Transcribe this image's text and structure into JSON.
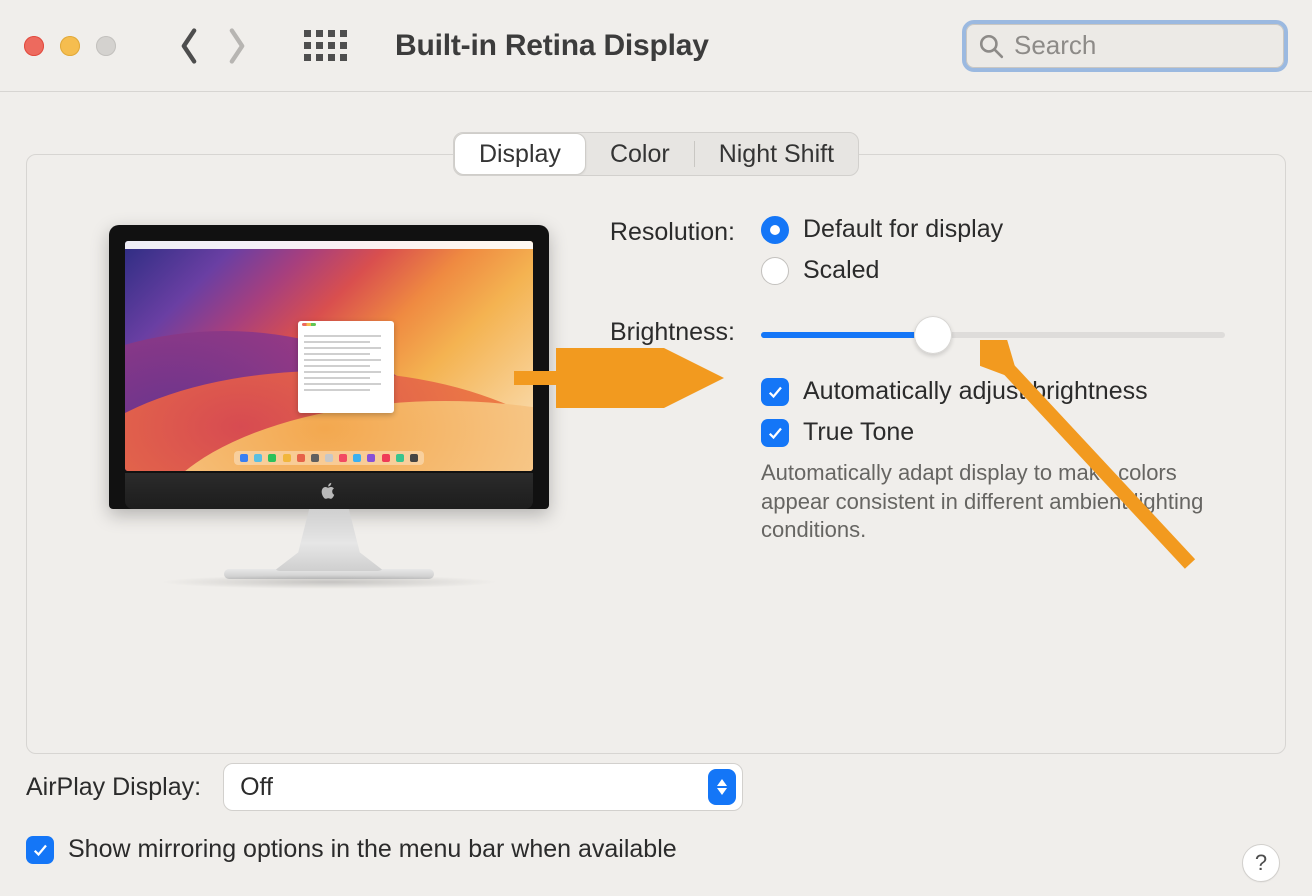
{
  "toolbar": {
    "title": "Built-in Retina Display",
    "search_placeholder": "Search"
  },
  "tabs": {
    "display": "Display",
    "color": "Color",
    "night_shift": "Night Shift",
    "active_index": 0
  },
  "settings": {
    "resolution_label": "Resolution:",
    "resolution_options": {
      "default": "Default for display",
      "scaled": "Scaled"
    },
    "resolution_selected": "default",
    "brightness_label": "Brightness:",
    "brightness_value_percent": 37,
    "auto_brightness_label": "Automatically adjust brightness",
    "auto_brightness_checked": true,
    "true_tone_label": "True Tone",
    "true_tone_checked": true,
    "true_tone_caption": "Automatically adapt display to make colors appear consistent in different ambient lighting conditions."
  },
  "footer": {
    "airplay_label": "AirPlay Display:",
    "airplay_value": "Off",
    "mirroring_label": "Show mirroring options in the menu bar when available",
    "mirroring_checked": true,
    "help_label": "?"
  },
  "colors": {
    "accent": "#1476f7",
    "annotation": "#f29a1f"
  }
}
